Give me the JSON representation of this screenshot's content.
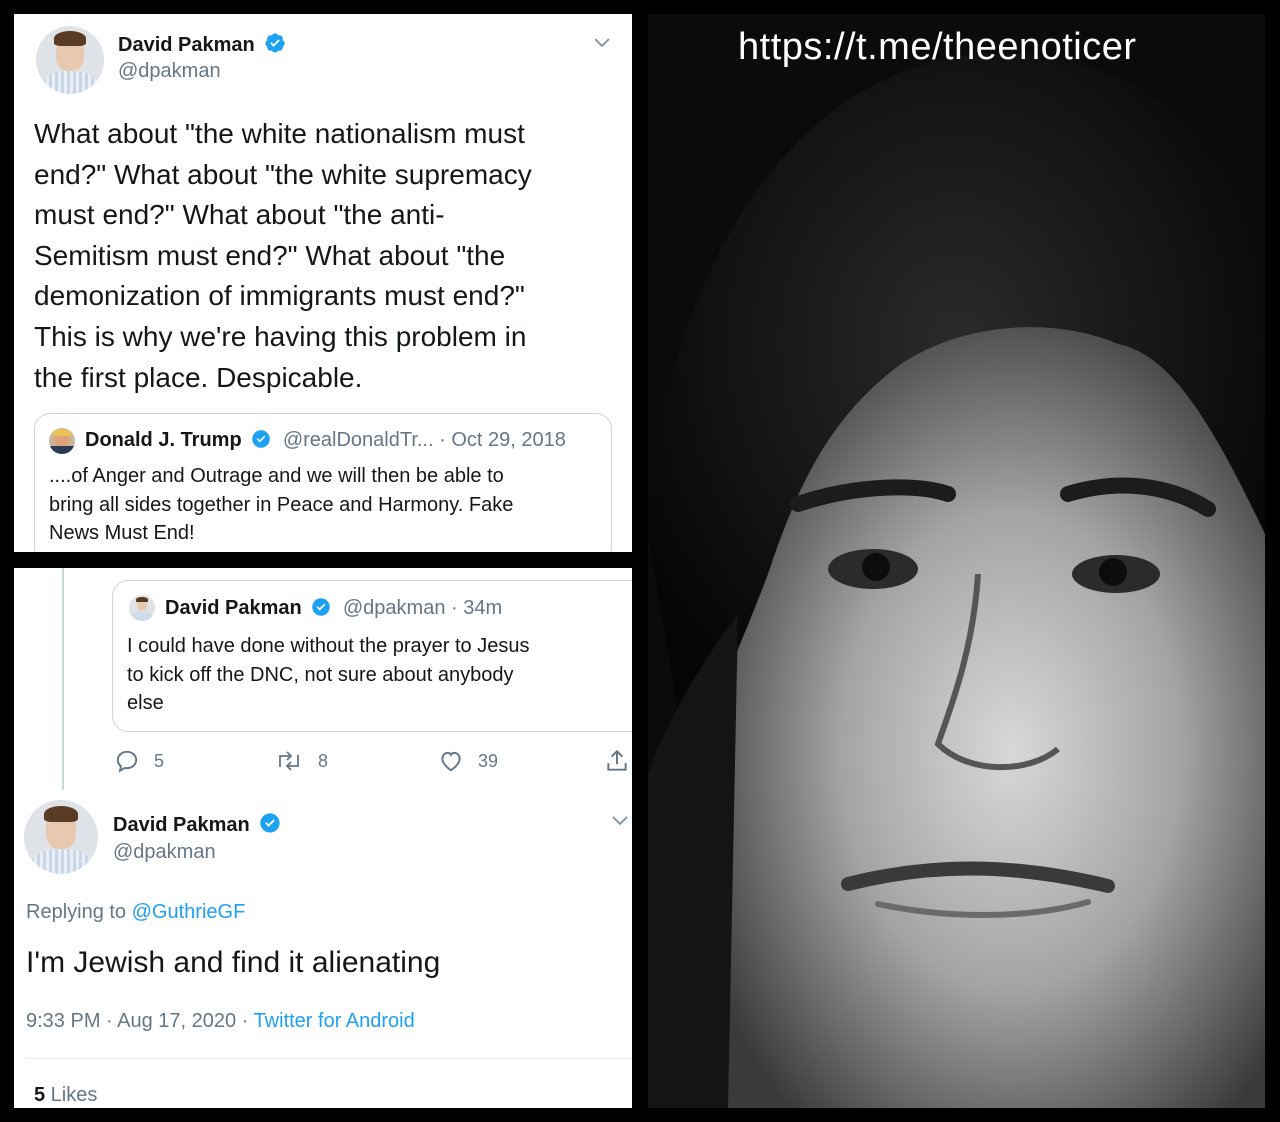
{
  "tweet_top": {
    "name": "David Pakman",
    "handle": "@dpakman",
    "text_lines": [
      "What about \"the white nationalism must",
      "end?\" What about \"the white supremacy",
      "must end?\" What about \"the anti-",
      "Semitism must end?\" What about \"the",
      "demonization of immigrants must end?\"",
      "This is why we're having this problem in",
      "the first place. Despicable."
    ],
    "quote": {
      "name": "Donald J. Trump",
      "handle_date": "@realDonaldTr... · Oct 29, 2018",
      "text_lines": [
        "....of Anger and Outrage and we will then be able to",
        "bring all sides together in Peace and Harmony. Fake",
        "News Must End!"
      ]
    }
  },
  "tweet_bottom": {
    "quote": {
      "name": "David Pakman",
      "handle_time": "@dpakman · 34m",
      "text_lines": [
        "I could have done without the prayer to Jesus",
        "to kick off the DNC, not sure about anybody",
        "else"
      ]
    },
    "actions": {
      "replies": "5",
      "retweets": "8",
      "likes": "39"
    },
    "reply": {
      "name": "David Pakman",
      "handle": "@dpakman",
      "replying_prefix": "Replying to ",
      "replying_to": "@GuthrieGF",
      "text": "I'm Jewish and find it alienating",
      "time": "9:33 PM · Aug 17, 2020 · ",
      "source": "Twitter for Android",
      "likes_count": "5",
      "likes_label": " Likes"
    }
  },
  "photo": {
    "watermark": "https://t.me/theenoticer"
  },
  "colors": {
    "verified": "#1da1f2",
    "link": "#1da1f2",
    "muted": "#657786",
    "border": "#ccd6dd"
  },
  "icons": [
    "verified-badge-icon",
    "chevron-down-icon",
    "reply-icon",
    "retweet-icon",
    "heart-icon",
    "share-icon"
  ]
}
